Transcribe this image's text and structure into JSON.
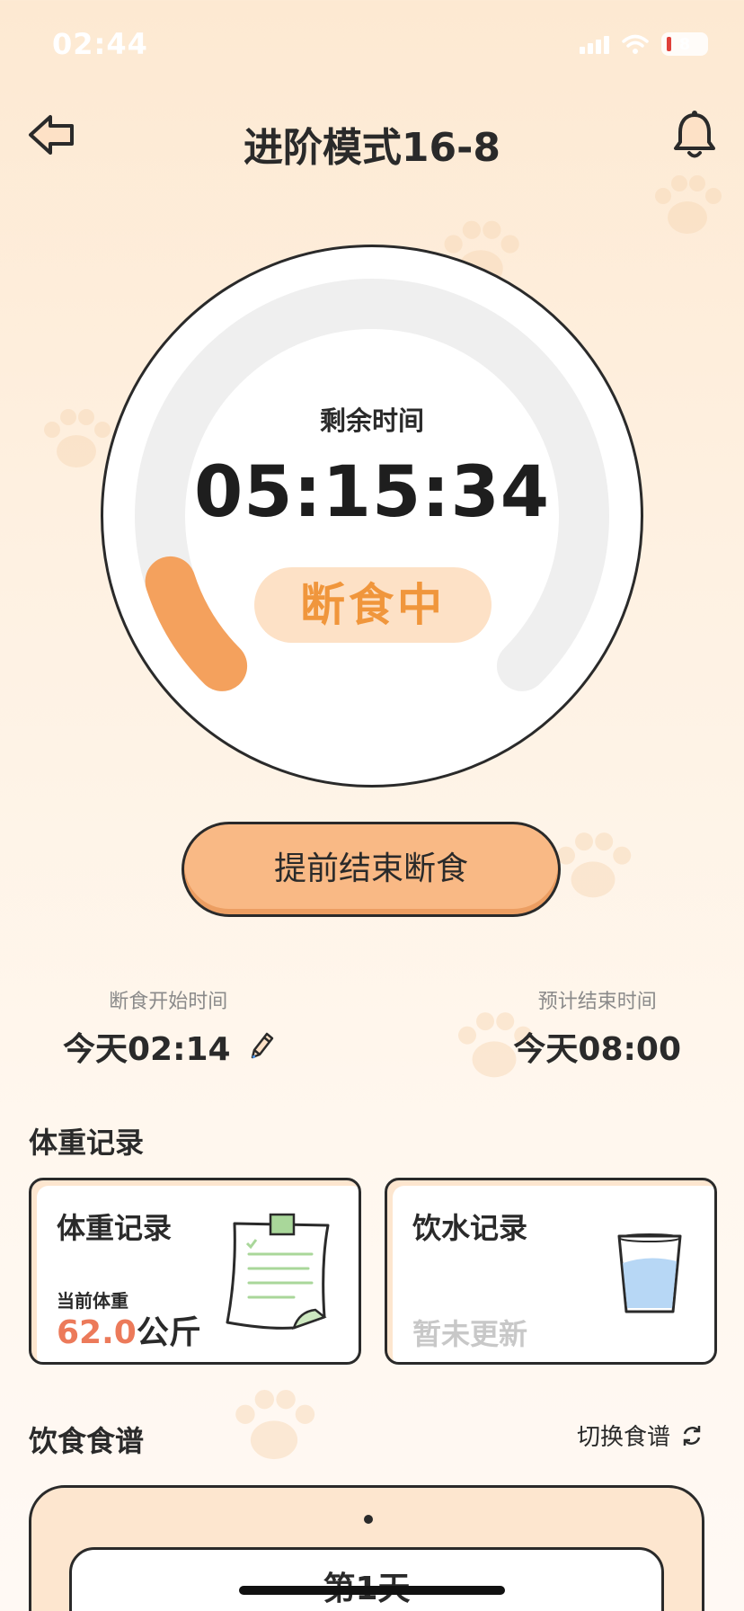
{
  "status_bar": {
    "time": "02:44",
    "battery": "8"
  },
  "header": {
    "title": "进阶模式16-8"
  },
  "timer": {
    "remaining_label": "剩余时间",
    "remaining_time": "05:15:34",
    "status": "断食中",
    "progress_fraction": 0.1
  },
  "actions": {
    "end_fast_label": "提前结束断食"
  },
  "fast_times": {
    "start_label": "断食开始时间",
    "start_value": "今天02:14",
    "end_label": "预计结束时间",
    "end_value": "今天08:00"
  },
  "weight_section": {
    "title": "体重记录"
  },
  "weight_card": {
    "title": "体重记录",
    "current_label": "当前体重",
    "value": "62.0",
    "unit": "公斤"
  },
  "water_card": {
    "title": "饮水记录",
    "status": "暂未更新"
  },
  "recipe_section": {
    "title": "饮食食谱",
    "switch_label": "切换食谱"
  },
  "recipe_card": {
    "day_label": "第1天"
  },
  "colors": {
    "accent": "#f4a15d",
    "pill_bg": "#fde1c6",
    "ring_track": "#efefef",
    "weight_value": "#ec7a5a"
  }
}
